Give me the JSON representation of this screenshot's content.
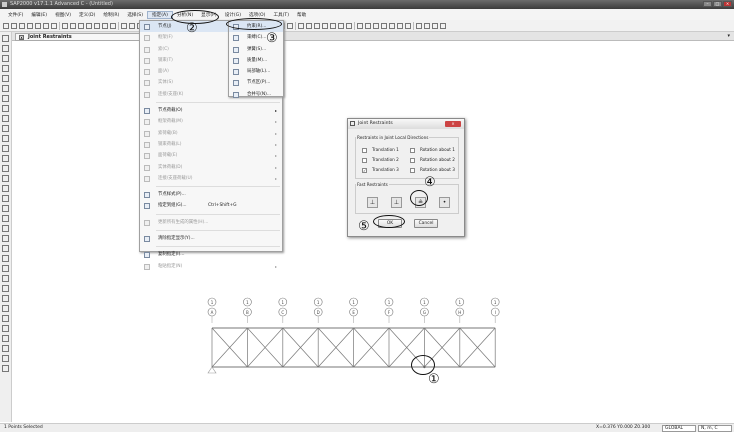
{
  "window": {
    "title": "SAP2000 v17.1.1 Advanced C - (Untitled)",
    "buttons": [
      "–",
      "□",
      "×"
    ]
  },
  "menubar": [
    "文件(F)",
    "编辑(E)",
    "视图(V)",
    "定义(D)",
    "绘制(R)",
    "选择(S)",
    "指定(A)",
    "分析(N)",
    "显示(P)",
    "设计(G)",
    "选项(O)",
    "工具(T)",
    "帮助"
  ],
  "doc_tab": {
    "title": "Joint Restraints",
    "close": "x",
    "dropdown": "▾"
  },
  "assign_menu": {
    "items": [
      {
        "label": "节点(J)",
        "arrow": "▸"
      },
      {
        "label": "框架(F)",
        "arrow": "▸"
      },
      {
        "label": "索(C)",
        "arrow": "▸"
      },
      {
        "label": "钢束(T)",
        "arrow": "▸"
      },
      {
        "label": "面(A)",
        "arrow": "▸"
      },
      {
        "label": "实体(S)",
        "arrow": "▸"
      },
      {
        "label": "连接/支座(K)",
        "arrow": "▸"
      },
      {
        "label": "节点荷载(O)",
        "arrow": "▸"
      },
      {
        "label": "框架荷载(M)",
        "arrow": "▸"
      },
      {
        "label": "索荷载(B)",
        "arrow": "▸"
      },
      {
        "label": "钢束荷载(L)",
        "arrow": "▸"
      },
      {
        "label": "面荷载(E)",
        "arrow": "▸"
      },
      {
        "label": "实体荷载(D)",
        "arrow": "▸"
      },
      {
        "label": "连接/支座荷载(U)",
        "arrow": "▸"
      },
      {
        "label": "节点样式(P)..."
      },
      {
        "label": "指定到组(G)...",
        "shortcut": "Ctrl+Shift+G"
      },
      {
        "label": "更新所有生成的属性(H)..."
      },
      {
        "label": "清除指定显示(Y)..."
      },
      {
        "label": "复制指定(I)..."
      },
      {
        "label": "粘贴指定(N)",
        "arrow": "▸"
      }
    ]
  },
  "joint_submenu": {
    "items": [
      "约束(R)...",
      "束缚(C)...",
      "弹簧(S)...",
      "质量(M)...",
      "局部轴(L)...",
      "节点区(P)...",
      "合并号(N)..."
    ]
  },
  "dialog": {
    "title": "Joint Restraints",
    "close": "×",
    "group1": "Restraints in Joint Local Directions",
    "checks": [
      {
        "label": "Translation 1",
        "checked": false
      },
      {
        "label": "Rotation about 1",
        "checked": false
      },
      {
        "label": "Translation 2",
        "checked": false
      },
      {
        "label": "Rotation about 2",
        "checked": false
      },
      {
        "label": "Translation 3",
        "checked": true
      },
      {
        "label": "Rotation about 3",
        "checked": false
      }
    ],
    "check_mark": "✓",
    "group2": "Fast Restraints",
    "fast_restraints": [
      "fixed",
      "pinned",
      "roller",
      "free"
    ],
    "ok": "OK",
    "cancel": "Cancel"
  },
  "grid": {
    "row_labels": [
      "1",
      "1",
      "1",
      "1",
      "1",
      "1",
      "1",
      "1",
      "1"
    ],
    "col_labels": [
      "A",
      "B",
      "C",
      "D",
      "E",
      "F",
      "G",
      "H",
      "I"
    ],
    "selected_bay_joint": 6
  },
  "callouts": [
    "①",
    "②",
    "③",
    "④",
    "⑤"
  ],
  "statusbar": {
    "left": "1 Points Selected",
    "coords": "X=0.376  Y0.000  Z0.300",
    "coord_system": "GLOBAL",
    "units": "N, m, C"
  }
}
